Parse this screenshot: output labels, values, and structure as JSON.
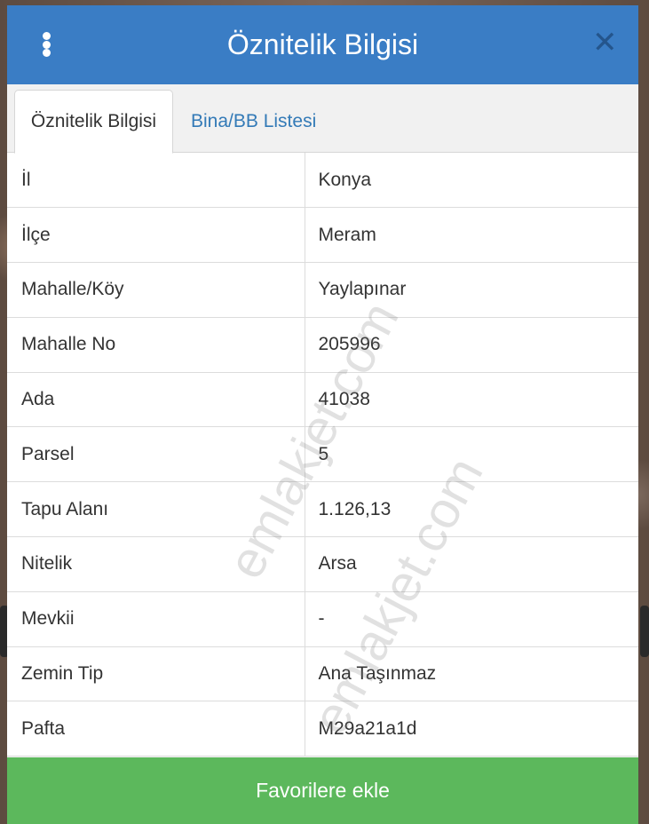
{
  "header": {
    "title": "Öznitelik Bilgisi",
    "close_symbol": "✕"
  },
  "tabs": [
    {
      "label": "Öznitelik Bilgisi",
      "active": true
    },
    {
      "label": "Bina/BB Listesi",
      "active": false
    }
  ],
  "attributes": [
    {
      "key": "İl",
      "value": "Konya"
    },
    {
      "key": "İlçe",
      "value": "Meram"
    },
    {
      "key": "Mahalle/Köy",
      "value": "Yaylapınar"
    },
    {
      "key": "Mahalle No",
      "value": "205996"
    },
    {
      "key": "Ada",
      "value": "41038"
    },
    {
      "key": "Parsel",
      "value": "5"
    },
    {
      "key": "Tapu Alanı",
      "value": "1.126,13"
    },
    {
      "key": "Nitelik",
      "value": "Arsa"
    },
    {
      "key": "Mevkii",
      "value": "-"
    },
    {
      "key": "Zemin Tip",
      "value": "Ana Taşınmaz"
    },
    {
      "key": "Pafta",
      "value": "M29a21a1d"
    }
  ],
  "footer": {
    "favorite_label": "Favorilere ekle"
  },
  "watermark": {
    "text": "emlakjet.com"
  },
  "colors": {
    "header_bg": "#3a7dc5",
    "tab_link": "#337ab7",
    "favorite_bg": "#5cb85c",
    "close_icon": "#24558c"
  }
}
